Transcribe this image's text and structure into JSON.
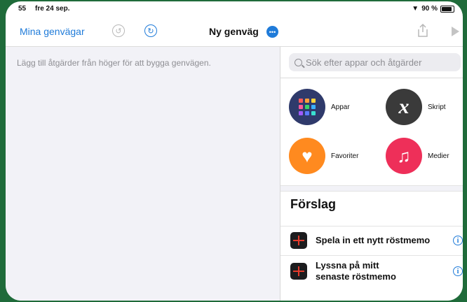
{
  "status_bar": {
    "time": "55",
    "date": "fre 24 sep.",
    "wifi": "wifi-icon",
    "battery_label": "90 %",
    "battery_level": 0.9
  },
  "nav": {
    "back_label": "Mina genvägar",
    "title": "Ny genväg"
  },
  "editor": {
    "hint": "Lägg till åtgärder från höger för att bygga genvägen."
  },
  "search": {
    "placeholder": "Sök efter appar och åtgärder"
  },
  "categories": [
    {
      "label": "Appar",
      "icon": "apps-grid-icon",
      "color": "#2f3a6b"
    },
    {
      "label": "Skript",
      "icon": "script-x-icon",
      "color": "#3a3a3a"
    },
    {
      "label": "Favoriter",
      "icon": "heart-icon",
      "color": "#ff8a1f"
    },
    {
      "label": "Medier",
      "icon": "music-note-icon",
      "color": "#ee2f59"
    }
  ],
  "suggestions": {
    "heading": "Förslag",
    "items": [
      {
        "label": "Spela in ett nytt röstmemo"
      },
      {
        "label_line1": "Lyssna på mitt",
        "label_line2": "senaste röstmemo"
      }
    ]
  },
  "colors": {
    "accent": "#1f7bd9",
    "background": "#1f6b3a"
  }
}
